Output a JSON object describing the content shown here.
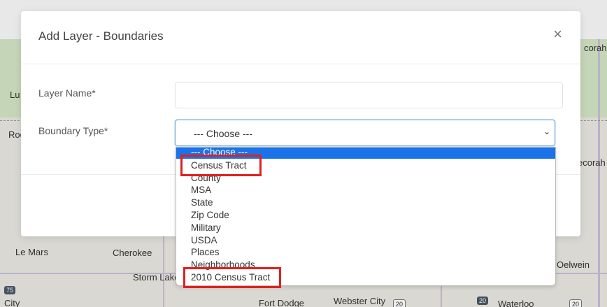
{
  "map": {
    "places": [
      "Lu",
      "Roc",
      "Le Mars",
      "Cherokee",
      "Storm Lake",
      "City",
      "Fort Dodge",
      "Webster City",
      "Waterloo",
      "Oelwein",
      "ecorah",
      "corah"
    ],
    "shields": [
      "75",
      "20",
      "20",
      "20"
    ]
  },
  "modal": {
    "title": "Add Layer - Boundaries",
    "close": "×",
    "layer_name_label": "Layer Name*",
    "layer_name_value": "",
    "boundary_type_label": "Boundary Type*",
    "boundary_type_value": "--- Choose ---"
  },
  "dropdown": {
    "options": [
      "--- Choose ---",
      "Census Tract",
      "County",
      "MSA",
      "State",
      "Zip Code",
      "Military",
      "USDA",
      "Places",
      "Neighborhoods",
      "2010 Census Tract"
    ],
    "selected_index": 0
  },
  "colors": {
    "selected": "#1a73e8",
    "highlight": "#e02020"
  }
}
